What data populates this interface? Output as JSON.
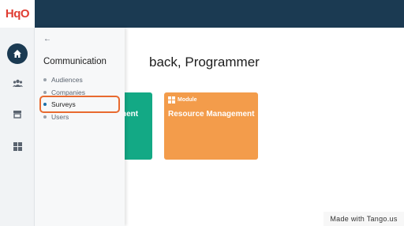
{
  "app": {
    "logo_text": "HqO"
  },
  "rail": {
    "items": [
      {
        "icon": "home-icon",
        "active": true
      },
      {
        "icon": "people-icon",
        "active": false
      },
      {
        "icon": "store-icon",
        "active": false
      },
      {
        "icon": "grid-icon",
        "active": false
      }
    ]
  },
  "panel": {
    "back_icon": "←",
    "title": "Communication",
    "items": [
      {
        "label": "Audiences",
        "active": false
      },
      {
        "label": "Companies",
        "active": false
      },
      {
        "label": "Surveys",
        "active": true
      },
      {
        "label": "Users",
        "active": false
      }
    ]
  },
  "main": {
    "welcome_visible": "back, Programmer",
    "card_green_visible": "nent",
    "card_orange": {
      "badge": "Module",
      "title": "Resource Management"
    }
  },
  "watermark": "Made with Tango.us",
  "colors": {
    "topbar": "#1b3a52",
    "highlight": "#e86a2f",
    "green": "#13a985",
    "orange": "#f39c4b"
  }
}
